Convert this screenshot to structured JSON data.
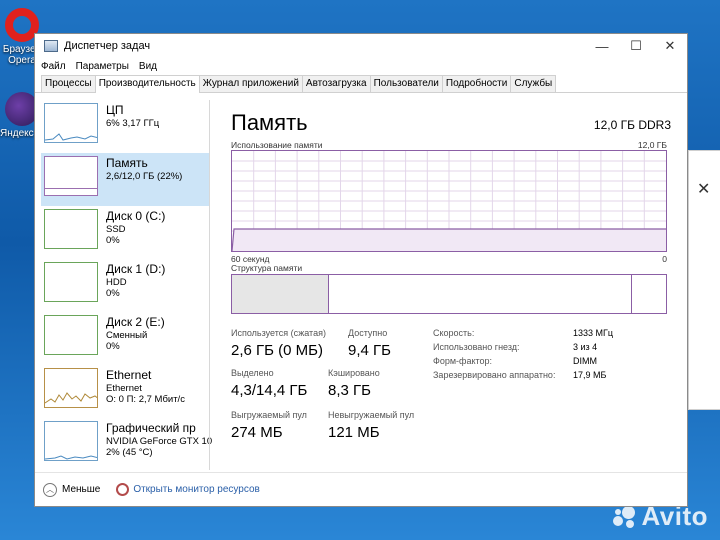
{
  "desktop": {
    "opera_label": "Браузер Opera",
    "yandex_label": "Яндекс.Игры",
    "watermark": "Avito"
  },
  "window": {
    "title": "Диспетчер задач",
    "controls": {
      "minimize": "—",
      "maximize": "☐",
      "close": "✕"
    }
  },
  "menu": [
    "Файл",
    "Параметры",
    "Вид"
  ],
  "tabs": [
    "Процессы",
    "Производительность",
    "Журнал приложений",
    "Автозагрузка",
    "Пользователи",
    "Подробности",
    "Службы"
  ],
  "active_tab": "Производительность",
  "sidebar": [
    {
      "name": "ЦП",
      "line1": "6%  3,17 ГГц",
      "line2": "",
      "line3": ""
    },
    {
      "name": "Память",
      "line1": "2,6/12,0 ГБ (22%)",
      "line2": "",
      "line3": ""
    },
    {
      "name": "Диск 0 (C:)",
      "line1": "SSD",
      "line2": "0%",
      "line3": ""
    },
    {
      "name": "Диск 1 (D:)",
      "line1": "HDD",
      "line2": "0%",
      "line3": ""
    },
    {
      "name": "Диск 2 (E:)",
      "line1": "Сменный",
      "line2": "0%",
      "line3": ""
    },
    {
      "name": "Ethernet",
      "line1": "Ethernet",
      "line2": "О: 0 П: 2,7 Мбит/с",
      "line3": ""
    },
    {
      "name": "Графический пр",
      "line1": "NVIDIA GeForce GTX 10",
      "line2": "2%  (45 °C)",
      "line3": ""
    }
  ],
  "main": {
    "title": "Память",
    "spec": "12,0 ГБ DDR3",
    "usage_label": "Использование памяти",
    "usage_max": "12,0 ГБ",
    "time_left": "60 секунд",
    "time_right": "0",
    "structure_label": "Структура памяти",
    "usage_fraction": 0.22
  },
  "stats": {
    "in_use_label": "Используется (сжатая)",
    "in_use_value": "2,6 ГБ (0 МБ)",
    "available_label": "Доступно",
    "available_value": "9,4 ГБ",
    "committed_label": "Выделено",
    "committed_value": "4,3/14,4 ГБ",
    "cached_label": "Кэшировано",
    "cached_value": "8,3 ГБ",
    "paged_label": "Выгружаемый пул",
    "paged_value": "274 МБ",
    "nonpaged_label": "Невыгружаемый пул",
    "nonpaged_value": "121 МБ"
  },
  "specs": {
    "speed_label": "Скорость:",
    "speed_value": "1333 МГц",
    "slots_label": "Использовано гнезд:",
    "slots_value": "3 из 4",
    "form_label": "Форм-фактор:",
    "form_value": "DIMM",
    "reserved_label": "Зарезервировано аппаратно:",
    "reserved_value": "17,9 МБ"
  },
  "footer": {
    "less": "Меньше",
    "monitor": "Открыть монитор ресурсов"
  }
}
